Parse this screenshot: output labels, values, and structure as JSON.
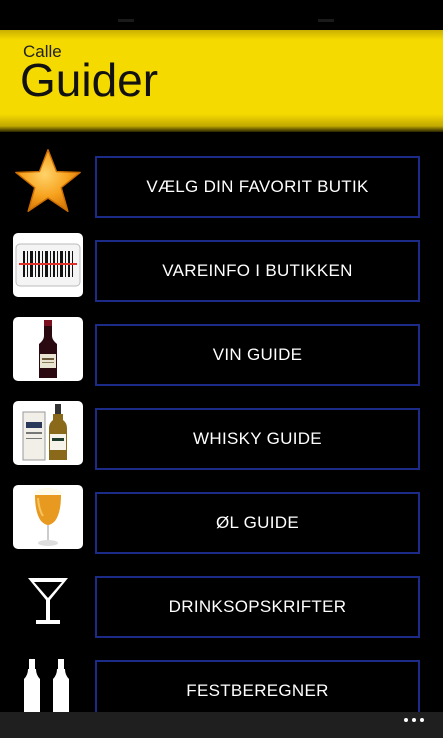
{
  "header": {
    "subtitle": "Calle",
    "title": "Guider"
  },
  "menu": [
    {
      "label": "VÆLG DIN FAVORIT BUTIK",
      "icon": "star-icon"
    },
    {
      "label": "VAREINFO I BUTIKKEN",
      "icon": "barcode-scanner-icon"
    },
    {
      "label": "VIN GUIDE",
      "icon": "wine-bottle-icon"
    },
    {
      "label": "WHISKY GUIDE",
      "icon": "whisky-bottle-icon"
    },
    {
      "label": "ØL GUIDE",
      "icon": "beer-glass-icon"
    },
    {
      "label": "DRINKSOPSKRIFTER",
      "icon": "cocktail-glass-icon"
    },
    {
      "label": "FESTBEREGNER",
      "icon": "bottles-icon"
    }
  ],
  "colors": {
    "header": "#f5da00",
    "button_border": "#1c2a88",
    "background": "#000000",
    "app_bar": "#1f1f1f"
  },
  "app_bar": {
    "icon": "more-options-icon"
  }
}
